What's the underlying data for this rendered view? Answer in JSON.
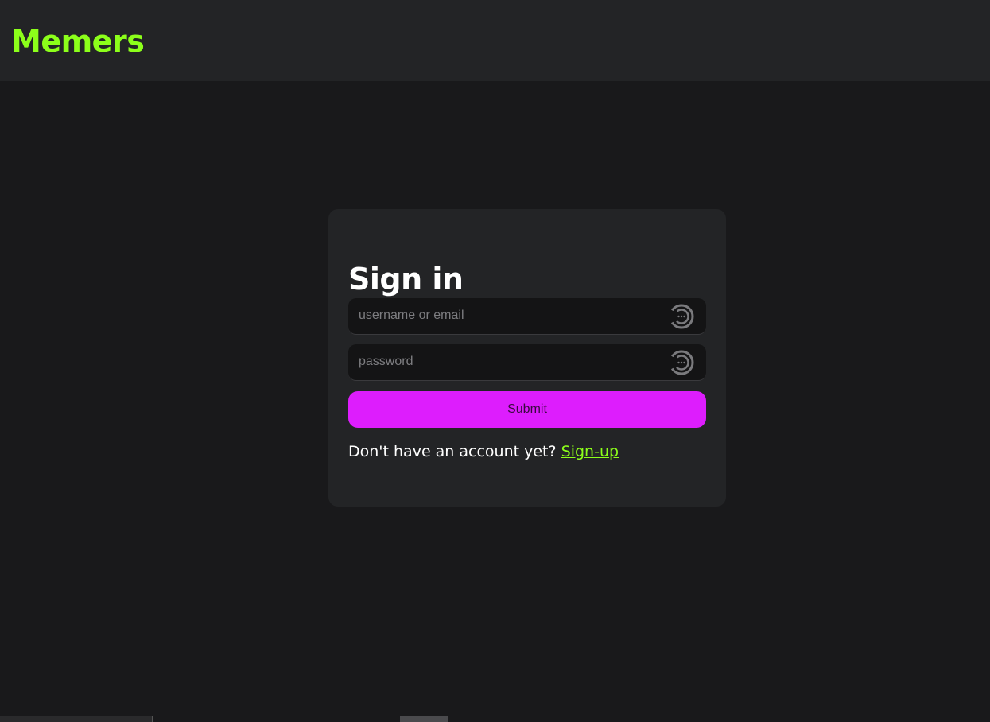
{
  "header": {
    "brand": "Memers"
  },
  "signin": {
    "title": "Sign in",
    "username_placeholder": "username or email",
    "username_value": "",
    "password_placeholder": "password",
    "password_value": "",
    "submit_label": "Submit",
    "signup_prompt": "Don't have an account yet? ",
    "signup_link": "Sign-up"
  },
  "icons": {
    "field_icon": "password-manager-icon"
  },
  "colors": {
    "brand": "#8cff1a",
    "accent": "#dd1dfd",
    "link": "#8cff1a",
    "background": "#19191b",
    "panel": "#232426"
  }
}
